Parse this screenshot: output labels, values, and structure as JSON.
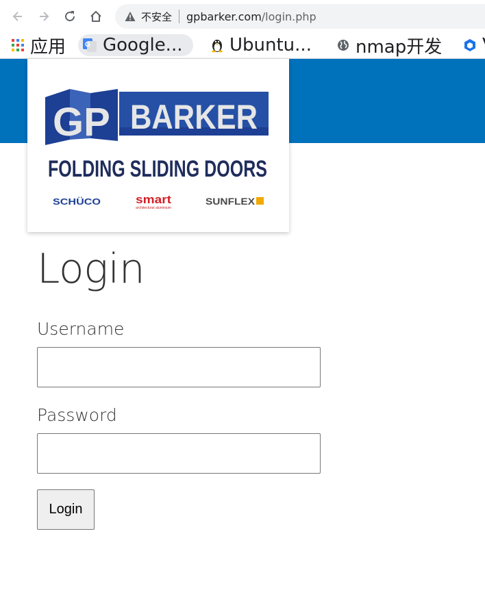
{
  "browser": {
    "security_label": "不安全",
    "url_host": "gpbarker.com",
    "url_path": "/login.php",
    "bookmarks": [
      {
        "label": "应用",
        "icon": "apps-grid-icon"
      },
      {
        "label": "Google...",
        "icon": "google-translate-icon"
      },
      {
        "label": "Ubuntu...",
        "icon": "tux-penguin-icon"
      },
      {
        "label": "nmap开发",
        "icon": "globe-icon"
      },
      {
        "label": "V",
        "icon": "blue-cube-icon"
      }
    ]
  },
  "logo": {
    "brand_gp": "GP",
    "brand_name": "BARKER",
    "tagline": "FOLDING SLIDING DOORS",
    "partner_1": "SCHÜCO",
    "partner_2": "smart",
    "partner_2_sub": "architectural aluminium",
    "partner_3": "SUNFLEX"
  },
  "form": {
    "title": "Login",
    "username_label": "Username",
    "username_value": "",
    "password_label": "Password",
    "password_value": "",
    "submit_label": "Login"
  },
  "colors": {
    "header_blue": "#0071bb",
    "logo_blue": "#1d3f94",
    "text": "#333333"
  }
}
